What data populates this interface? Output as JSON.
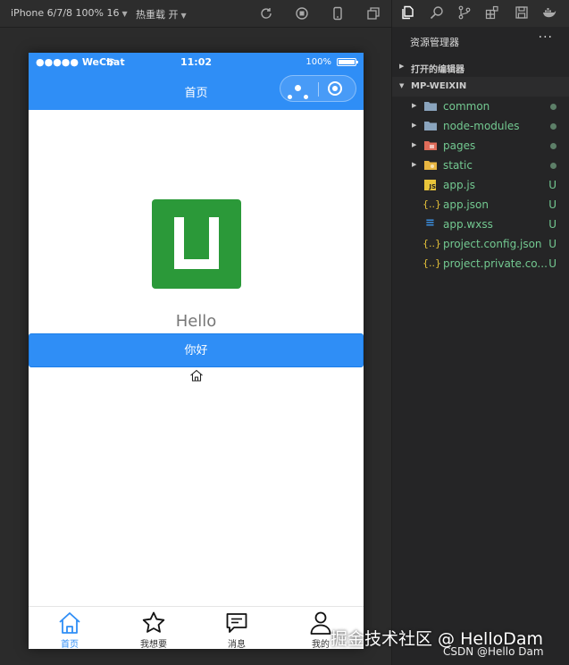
{
  "toolbar": {
    "device": "iPhone 6/7/8 100% 16",
    "hotreload": "热重载 开"
  },
  "phone": {
    "status": {
      "carrier": "●●●●● WeChat",
      "time": "11:02",
      "battery": "100%"
    },
    "nav_title": "首页",
    "hello": "Hello",
    "button_label": "你好",
    "tabs": [
      {
        "label": "首页",
        "icon": "home-icon",
        "active": true
      },
      {
        "label": "我想要",
        "icon": "star-icon",
        "active": false
      },
      {
        "label": "消息",
        "icon": "message-icon",
        "active": false
      },
      {
        "label": "我的",
        "icon": "user-icon",
        "active": false
      }
    ],
    "colors": {
      "primary": "#2f8ef6",
      "logo": "#2b9939"
    }
  },
  "explorer": {
    "title": "资源管理器",
    "more": "···",
    "open_editors": "打开的编辑器",
    "project": "MP-WEIXIN",
    "items": [
      {
        "name": "common",
        "kind": "folder",
        "color": "#8aa4bd",
        "status": "dot"
      },
      {
        "name": "node-modules",
        "kind": "folder",
        "color": "#8aa4bd",
        "status": "dot"
      },
      {
        "name": "pages",
        "kind": "folder",
        "color": "#e06c5a",
        "status": "dot"
      },
      {
        "name": "static",
        "kind": "folder",
        "color": "#e8b641",
        "status": "dot"
      },
      {
        "name": "app.js",
        "kind": "js",
        "icon_text": "JS",
        "status": "U"
      },
      {
        "name": "app.json",
        "kind": "json",
        "icon_text": "{..}",
        "status": "U"
      },
      {
        "name": "app.wxss",
        "kind": "css",
        "icon_text": "≡",
        "status": "U"
      },
      {
        "name": "project.config.json",
        "kind": "json",
        "icon_text": "{..}",
        "status": "U"
      },
      {
        "name": "project.private.co...",
        "kind": "json",
        "icon_text": "{..}",
        "status": "U"
      }
    ]
  },
  "watermark": {
    "main": "掘金技术社区 @ HelloDam",
    "sub": "CSDN @Hello Dam"
  }
}
